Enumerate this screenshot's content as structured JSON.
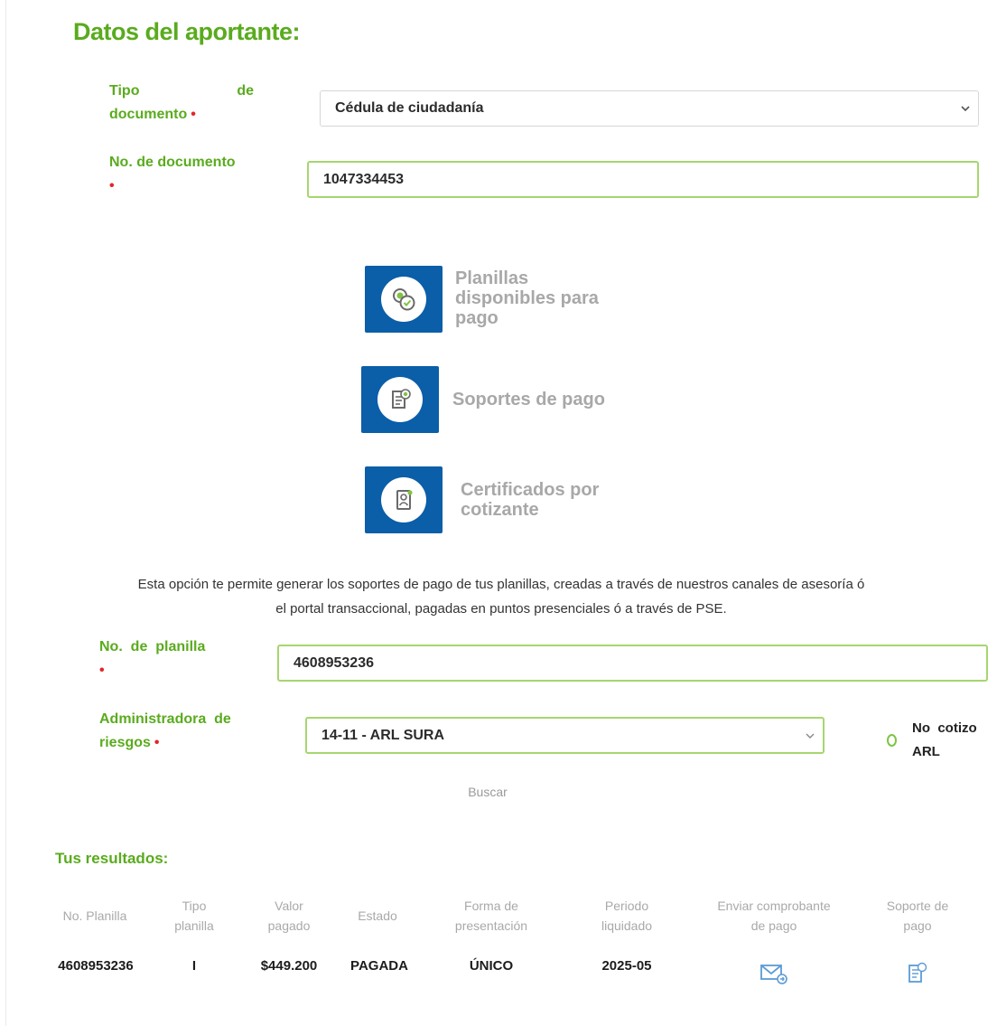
{
  "page": {
    "title": "Datos del aportante:"
  },
  "form": {
    "doc_type_label_1": "Tipo",
    "doc_type_label_de": "de",
    "doc_type_label_2": "documento",
    "doc_type_value": "Cédula de ciudadanía",
    "doc_number_label": "No. de documento",
    "doc_number_value": "1047334453",
    "required_mark": "•"
  },
  "options": [
    {
      "label_lines": [
        "Planillas",
        "disponibles para",
        "pago"
      ],
      "icon": "coins-check-icon"
    },
    {
      "label_lines": [
        "Soportes de pago"
      ],
      "icon": "receipt-dollar-icon"
    },
    {
      "label_lines": [
        "Certificados por",
        "cotizante"
      ],
      "icon": "certificate-user-icon"
    }
  ],
  "info": {
    "line1": "Esta opción te permite generar los soportes de pago de tus planillas, creadas a través de nuestros canales de asesoría ó",
    "line2": "el portal transaccional, pagadas en puntos presenciales ó a través de PSE."
  },
  "search": {
    "planilla_label_1": "No.  de  planilla",
    "planilla_value": "4608953236",
    "arl_label_1": "Administradora  de",
    "arl_label_2": "riesgos",
    "arl_value": "14-11 - ARL SURA",
    "no_cotizo_1": "No  cotizo",
    "no_cotizo_2": "ARL",
    "buscar_label": "Buscar"
  },
  "results": {
    "title": "Tus resultados:",
    "headers": [
      [
        "No. Planilla"
      ],
      [
        "Tipo",
        "planilla"
      ],
      [
        "Valor",
        "pagado"
      ],
      [
        "Estado"
      ],
      [
        "Forma de",
        "presentación"
      ],
      [
        "Periodo",
        "liquidado"
      ],
      [
        "Enviar comprobante",
        "de pago"
      ],
      [
        "Soporte de",
        "pago"
      ]
    ],
    "rows": [
      {
        "planilla": "4608953236",
        "tipo": "I",
        "valor": "$449.200",
        "estado": "PAGADA",
        "forma": "ÚNICO",
        "periodo": "2025-05"
      }
    ]
  },
  "colors": {
    "brand_green": "#5aab1e",
    "tile_blue": "#0b5ea8",
    "icon_blue": "#5b9bd5",
    "required_red": "#e3262a"
  }
}
